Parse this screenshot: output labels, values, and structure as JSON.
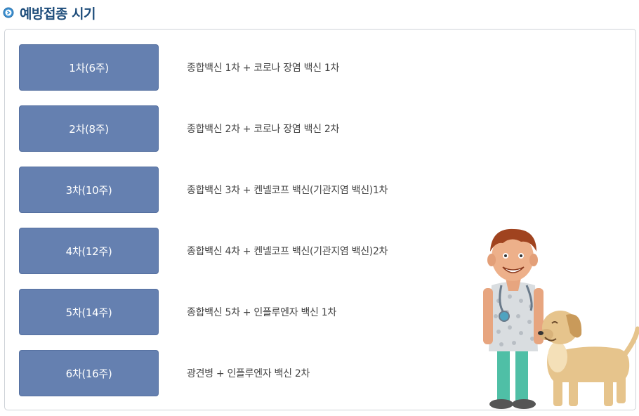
{
  "section": {
    "title": "예방접종 시기"
  },
  "schedule": [
    {
      "stage": "1차(6주)",
      "vaccines": "종합백신 1차 + 코로나 장염 백신 1차"
    },
    {
      "stage": "2차(8주)",
      "vaccines": "종합백신 2차 + 코로나 장염 백신 2차"
    },
    {
      "stage": "3차(10주)",
      "vaccines": "종합백신 3차 + 켄넬코프 백신(기관지염 백신)1차"
    },
    {
      "stage": "4차(12주)",
      "vaccines": "종합백신 4차 + 켄넬코프 백신(기관지염 백신)2차"
    },
    {
      "stage": "5차(14주)",
      "vaccines": "종합백신 5차 + 인플루엔자 백신 1차"
    },
    {
      "stage": "6차(16주)",
      "vaccines": "광견병 + 인플루엔자 백신 2차"
    }
  ],
  "icons": {
    "title_bullet": "circle-arrow-icon",
    "illustration": "veterinarian-with-dog-illustration"
  },
  "colors": {
    "title": "#1e4d7b",
    "stage_button": "#6580b0",
    "text": "#444444"
  }
}
